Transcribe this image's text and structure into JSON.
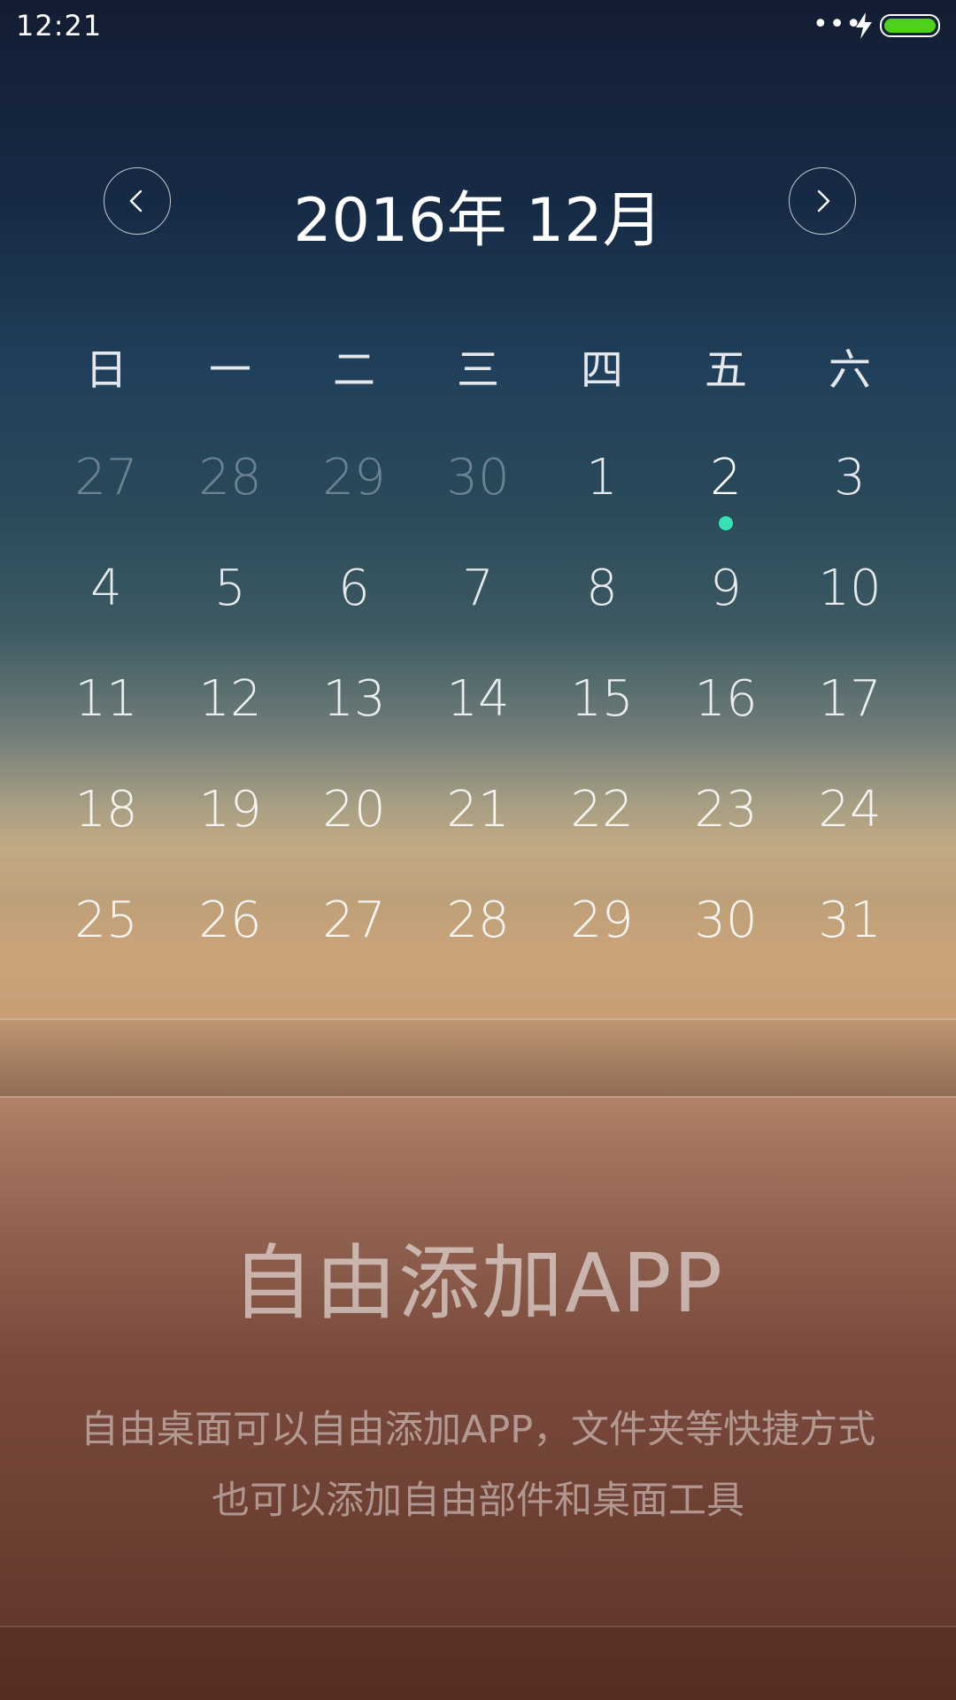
{
  "status_bar": {
    "time": "12:21",
    "dots": "•••",
    "charging_icon": "bolt-icon",
    "battery_icon": "battery-icon",
    "battery_color": "#4cd11e"
  },
  "calendar": {
    "title": "2016年 12月",
    "prev_icon": "chevron-left-icon",
    "next_icon": "chevron-right-icon",
    "weekdays": [
      "日",
      "一",
      "二",
      "三",
      "四",
      "五",
      "六"
    ],
    "today": "2",
    "today_dot_color": "#39e1b4",
    "rows": [
      [
        {
          "d": "27",
          "muted": true
        },
        {
          "d": "28",
          "muted": true
        },
        {
          "d": "29",
          "muted": true
        },
        {
          "d": "30",
          "muted": true
        },
        {
          "d": "1"
        },
        {
          "d": "2",
          "today": true
        },
        {
          "d": "3"
        }
      ],
      [
        {
          "d": "4"
        },
        {
          "d": "5"
        },
        {
          "d": "6"
        },
        {
          "d": "7"
        },
        {
          "d": "8"
        },
        {
          "d": "9"
        },
        {
          "d": "10"
        }
      ],
      [
        {
          "d": "11"
        },
        {
          "d": "12"
        },
        {
          "d": "13"
        },
        {
          "d": "14"
        },
        {
          "d": "15"
        },
        {
          "d": "16"
        },
        {
          "d": "17"
        }
      ],
      [
        {
          "d": "18"
        },
        {
          "d": "19"
        },
        {
          "d": "20"
        },
        {
          "d": "21"
        },
        {
          "d": "22"
        },
        {
          "d": "23"
        },
        {
          "d": "24"
        }
      ],
      [
        {
          "d": "25"
        },
        {
          "d": "26"
        },
        {
          "d": "27"
        },
        {
          "d": "28"
        },
        {
          "d": "29"
        },
        {
          "d": "30"
        },
        {
          "d": "31"
        }
      ]
    ]
  },
  "feature": {
    "title": "自由添加APP",
    "desc_line1": "自由桌面可以自由添加APP，文件夹等快捷方式",
    "desc_line2": "也可以添加自由部件和桌面工具"
  }
}
